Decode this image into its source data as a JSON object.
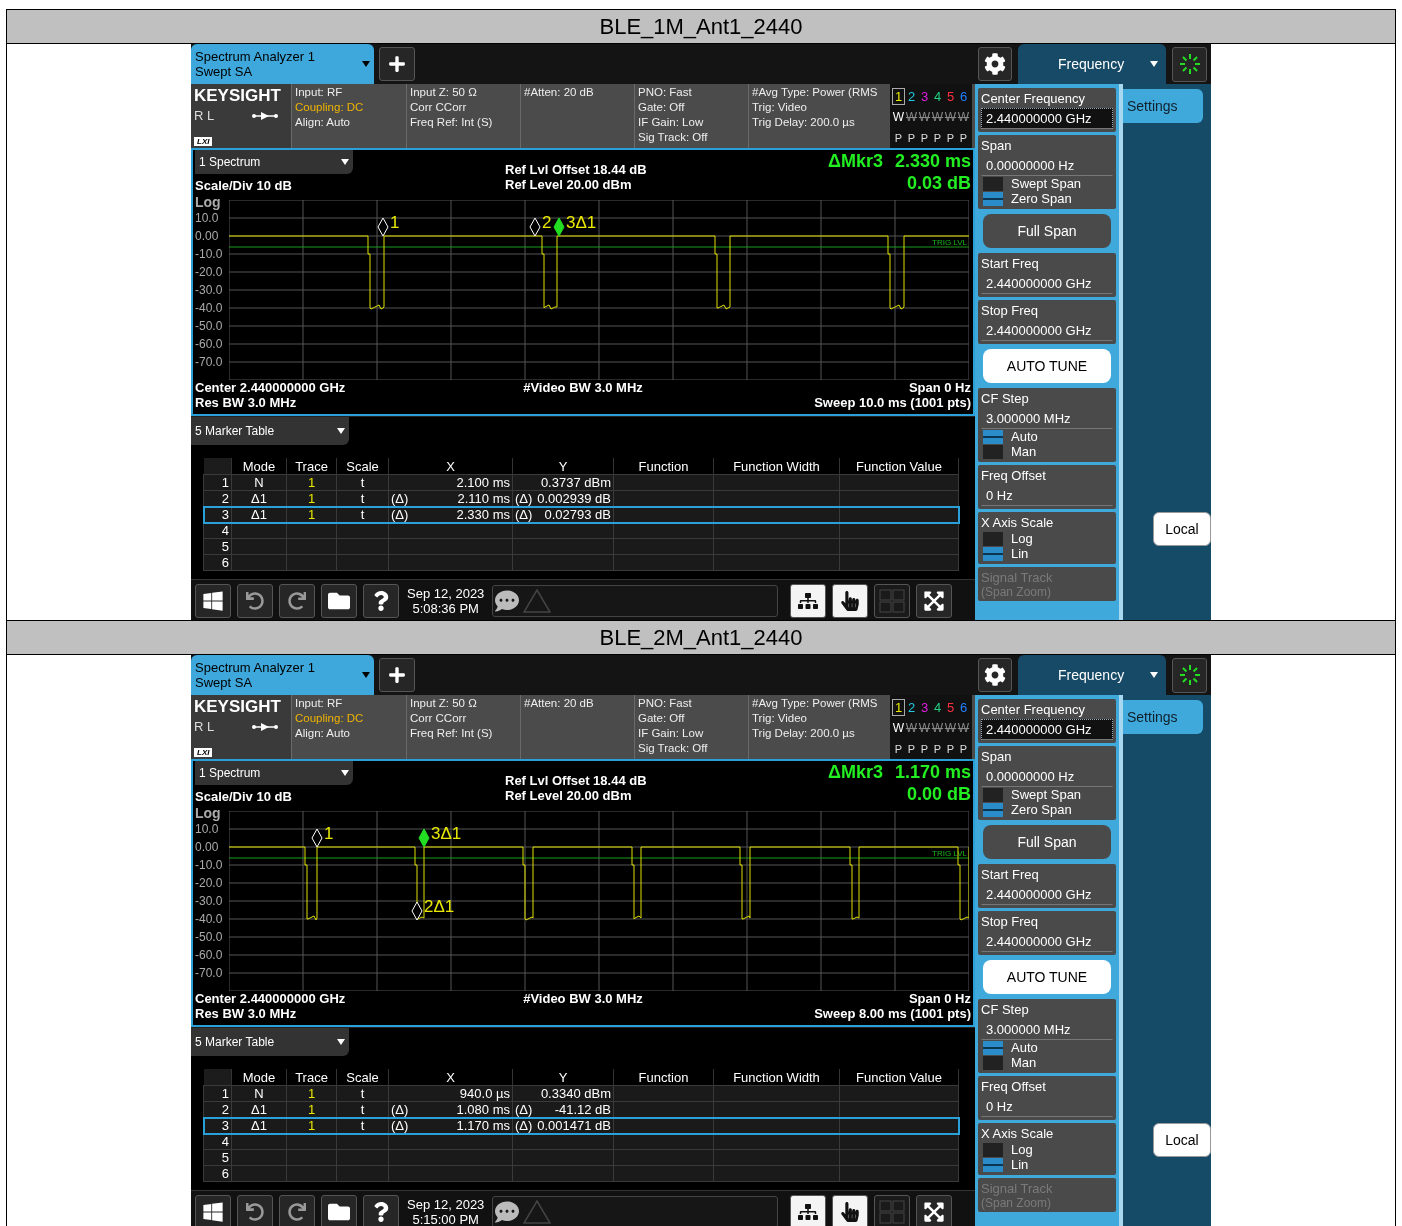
{
  "sections": [
    {
      "title": "BLE_1M_Ant1_2440",
      "instrument_tab": {
        "line_1": "Spectrum Analyzer 1",
        "line_2": "Swept SA"
      },
      "brand": {
        "logo": "KEYSIGHT",
        "status": "R L",
        "lxi": "LXI"
      },
      "settings": [
        [
          {
            "text": "Input: RF",
            "warning": false
          },
          {
            "text": "Coupling: DC",
            "warning": true
          },
          {
            "text": "Align: Auto",
            "warning": false
          }
        ],
        [
          {
            "text": "Input Z: 50 Ω",
            "warning": false
          },
          {
            "text": "Corr CCorr",
            "warning": false
          },
          {
            "text": "Freq Ref: Int (S)",
            "warning": false
          }
        ],
        [
          {
            "text": "#Atten: 20 dB",
            "warning": false
          }
        ],
        [
          {
            "text": "PNO: Fast",
            "warning": false
          },
          {
            "text": "Gate: Off",
            "warning": false
          },
          {
            "text": "IF Gain: Low",
            "warning": false
          },
          {
            "text": "Sig Track: Off",
            "warning": false
          }
        ],
        [
          {
            "text": "#Avg Type: Power (RMS",
            "warning": false
          },
          {
            "text": "Trig: Video",
            "warning": false
          },
          {
            "text": "Trig Delay: 200.0 µs",
            "warning": false
          }
        ]
      ],
      "traces": [
        {
          "number": "1",
          "color": "#e8e800",
          "selected": true,
          "mode": "W",
          "active": true,
          "detector": "P"
        },
        {
          "number": "2",
          "color": "#22c8e0",
          "selected": false,
          "mode": "W",
          "active": false,
          "detector": "P"
        },
        {
          "number": "3",
          "color": "#e020e0",
          "selected": false,
          "mode": "W",
          "active": false,
          "detector": "P"
        },
        {
          "number": "4",
          "color": "#20d080",
          "selected": false,
          "mode": "W",
          "active": false,
          "detector": "P"
        },
        {
          "number": "5",
          "color": "#ff3040",
          "selected": false,
          "mode": "W",
          "active": false,
          "detector": "P"
        },
        {
          "number": "6",
          "color": "#2080ff",
          "selected": false,
          "mode": "W",
          "active": false,
          "detector": "P"
        }
      ],
      "menu": {
        "label": "Frequency"
      },
      "panel_tab": {
        "label": "Settings",
        "selected": true
      },
      "softkeys": [
        {
          "kind": "field",
          "label": "Center Frequency",
          "value": "2.440000000 GHz",
          "focused": true
        },
        {
          "kind": "field",
          "label": "Span",
          "value": "0.00000000 Hz",
          "focused": false,
          "options": [
            {
              "label": "Swept Span",
              "selected": false
            },
            {
              "label": "Zero Span",
              "selected": true
            }
          ]
        },
        {
          "kind": "button",
          "label": "Full Span"
        },
        {
          "kind": "field",
          "label": "Start Freq",
          "value": "2.440000000 GHz",
          "focused": false
        },
        {
          "kind": "field",
          "label": "Stop Freq",
          "value": "2.440000000 GHz",
          "focused": false
        },
        {
          "kind": "action",
          "label": "AUTO TUNE"
        },
        {
          "kind": "field",
          "label": "CF Step",
          "value": "3.000000 MHz",
          "focused": false,
          "options": [
            {
              "label": "Auto",
              "selected": true
            },
            {
              "label": "Man",
              "selected": false
            }
          ]
        },
        {
          "kind": "field",
          "label": "Freq Offset",
          "value": "0 Hz",
          "focused": false
        },
        {
          "kind": "toggle",
          "label": "X Axis Scale",
          "options": [
            {
              "label": "Log",
              "selected": false
            },
            {
              "label": "Lin",
              "selected": true
            }
          ]
        },
        {
          "kind": "label",
          "label": "Signal Track",
          "sub": "(Span Zoom)",
          "disabled": true
        }
      ],
      "local_button": "Local",
      "spectrum": {
        "view": "1 Spectrum",
        "ref_offset": "Ref Lvl Offset 18.44 dB",
        "ref_level": "Ref Level 20.00 dBm",
        "scale": "Scale/Div 10 dB",
        "scale_type": "Log",
        "marker_readout": {
          "label": "ΔMkr3",
          "x": "2.330 ms",
          "y": "0.03 dB"
        },
        "y_labels": [
          "10.0",
          "0.00",
          "-10.0",
          "-20.0",
          "-30.0",
          "-40.0",
          "-50.0",
          "-60.0",
          "-70.0"
        ],
        "trigger_label": "TRIG LVL",
        "markers": [
          {
            "label": "1",
            "active": false
          },
          {
            "label": "2",
            "active": false
          },
          {
            "label": "3Δ1",
            "active": true
          }
        ],
        "footer": {
          "center": "Center 2.440000000 GHz",
          "video_bw": "#Video BW 3.0 MHz",
          "span": "Span 0 Hz",
          "res_bw": "Res BW 3.0 MHz",
          "sweep": "Sweep 10.0 ms (1001 pts)"
        }
      },
      "marker_table": {
        "view": "5 Marker Table",
        "columns": [
          "Mode",
          "Trace",
          "Scale",
          "X",
          "Y",
          "Function",
          "Function Width",
          "Function Value"
        ],
        "rows": [
          {
            "index": "1",
            "mode": "N",
            "trace": "1",
            "scale": "t",
            "x": "2.100 ms",
            "y": "0.3737 dBm",
            "selected": false
          },
          {
            "index": "2",
            "mode": "Δ1",
            "trace": "1",
            "scale": "t",
            "x_ref": "(Δ)",
            "x": "2.110 ms",
            "y_ref": "(Δ)",
            "y": "0.002939 dB",
            "selected": false
          },
          {
            "index": "3",
            "mode": "Δ1",
            "trace": "1",
            "scale": "t",
            "x_ref": "(Δ)",
            "x": "2.330 ms",
            "y_ref": "(Δ)",
            "y": "0.02793 dB",
            "selected": true
          },
          {
            "index": "4",
            "selected": false
          },
          {
            "index": "5",
            "selected": false
          },
          {
            "index": "6",
            "selected": false
          }
        ]
      },
      "taskbar": {
        "date": "Sep 12, 2023",
        "time": "5:08:36 PM"
      }
    },
    {
      "title": "BLE_2M_Ant1_2440",
      "instrument_tab": {
        "line_1": "Spectrum Analyzer 1",
        "line_2": "Swept SA"
      },
      "brand": {
        "logo": "KEYSIGHT",
        "status": "R L",
        "lxi": "LXI"
      },
      "settings": [
        [
          {
            "text": "Input: RF",
            "warning": false
          },
          {
            "text": "Coupling: DC",
            "warning": true
          },
          {
            "text": "Align: Auto",
            "warning": false
          }
        ],
        [
          {
            "text": "Input Z: 50 Ω",
            "warning": false
          },
          {
            "text": "Corr CCorr",
            "warning": false
          },
          {
            "text": "Freq Ref: Int (S)",
            "warning": false
          }
        ],
        [
          {
            "text": "#Atten: 20 dB",
            "warning": false
          }
        ],
        [
          {
            "text": "PNO: Fast",
            "warning": false
          },
          {
            "text": "Gate: Off",
            "warning": false
          },
          {
            "text": "IF Gain: Low",
            "warning": false
          },
          {
            "text": "Sig Track: Off",
            "warning": false
          }
        ],
        [
          {
            "text": "#Avg Type: Power (RMS",
            "warning": false
          },
          {
            "text": "Trig: Video",
            "warning": false
          },
          {
            "text": "Trig Delay: 200.0 µs",
            "warning": false
          }
        ]
      ],
      "traces": [
        {
          "number": "1",
          "color": "#e8e800",
          "selected": true,
          "mode": "W",
          "active": true,
          "detector": "P"
        },
        {
          "number": "2",
          "color": "#22c8e0",
          "selected": false,
          "mode": "W",
          "active": false,
          "detector": "P"
        },
        {
          "number": "3",
          "color": "#e020e0",
          "selected": false,
          "mode": "W",
          "active": false,
          "detector": "P"
        },
        {
          "number": "4",
          "color": "#20d080",
          "selected": false,
          "mode": "W",
          "active": false,
          "detector": "P"
        },
        {
          "number": "5",
          "color": "#ff3040",
          "selected": false,
          "mode": "W",
          "active": false,
          "detector": "P"
        },
        {
          "number": "6",
          "color": "#2080ff",
          "selected": false,
          "mode": "W",
          "active": false,
          "detector": "P"
        }
      ],
      "menu": {
        "label": "Frequency"
      },
      "panel_tab": {
        "label": "Settings",
        "selected": true
      },
      "softkeys": [
        {
          "kind": "field",
          "label": "Center Frequency",
          "value": "2.440000000 GHz",
          "focused": true
        },
        {
          "kind": "field",
          "label": "Span",
          "value": "0.00000000 Hz",
          "focused": false,
          "options": [
            {
              "label": "Swept Span",
              "selected": false
            },
            {
              "label": "Zero Span",
              "selected": true
            }
          ]
        },
        {
          "kind": "button",
          "label": "Full Span"
        },
        {
          "kind": "field",
          "label": "Start Freq",
          "value": "2.440000000 GHz",
          "focused": false
        },
        {
          "kind": "field",
          "label": "Stop Freq",
          "value": "2.440000000 GHz",
          "focused": false
        },
        {
          "kind": "action",
          "label": "AUTO TUNE"
        },
        {
          "kind": "field",
          "label": "CF Step",
          "value": "3.000000 MHz",
          "focused": false,
          "options": [
            {
              "label": "Auto",
              "selected": true
            },
            {
              "label": "Man",
              "selected": false
            }
          ]
        },
        {
          "kind": "field",
          "label": "Freq Offset",
          "value": "0 Hz",
          "focused": false
        },
        {
          "kind": "toggle",
          "label": "X Axis Scale",
          "options": [
            {
              "label": "Log",
              "selected": false
            },
            {
              "label": "Lin",
              "selected": true
            }
          ]
        },
        {
          "kind": "label",
          "label": "Signal Track",
          "sub": "(Span Zoom)",
          "disabled": true
        }
      ],
      "local_button": "Local",
      "spectrum": {
        "view": "1 Spectrum",
        "ref_offset": "Ref Lvl Offset 18.44 dB",
        "ref_level": "Ref Level 20.00 dBm",
        "scale": "Scale/Div 10 dB",
        "scale_type": "Log",
        "marker_readout": {
          "label": "ΔMkr3",
          "x": "1.170 ms",
          "y": "0.00 dB"
        },
        "y_labels": [
          "10.0",
          "0.00",
          "-10.0",
          "-20.0",
          "-30.0",
          "-40.0",
          "-50.0",
          "-60.0",
          "-70.0"
        ],
        "trigger_label": "TRIG LVL",
        "markers": [
          {
            "label": "1",
            "active": false
          },
          {
            "label": "2Δ1",
            "active": false
          },
          {
            "label": "3Δ1",
            "active": true
          }
        ],
        "footer": {
          "center": "Center 2.440000000 GHz",
          "video_bw": "#Video BW 3.0 MHz",
          "span": "Span 0 Hz",
          "res_bw": "Res BW 3.0 MHz",
          "sweep": "Sweep 8.00 ms (1001 pts)"
        }
      },
      "marker_table": {
        "view": "5 Marker Table",
        "columns": [
          "Mode",
          "Trace",
          "Scale",
          "X",
          "Y",
          "Function",
          "Function Width",
          "Function Value"
        ],
        "rows": [
          {
            "index": "1",
            "mode": "N",
            "trace": "1",
            "scale": "t",
            "x": "940.0 µs",
            "y": "0.3340 dBm",
            "selected": false
          },
          {
            "index": "2",
            "mode": "Δ1",
            "trace": "1",
            "scale": "t",
            "x_ref": "(Δ)",
            "x": "1.080 ms",
            "y_ref": "(Δ)",
            "y": "-41.12 dB",
            "selected": false
          },
          {
            "index": "3",
            "mode": "Δ1",
            "trace": "1",
            "scale": "t",
            "x_ref": "(Δ)",
            "x": "1.170 ms",
            "y_ref": "(Δ)",
            "y": "0.001471 dB",
            "selected": true
          },
          {
            "index": "4",
            "selected": false
          },
          {
            "index": "5",
            "selected": false
          },
          {
            "index": "6",
            "selected": false
          }
        ]
      },
      "taskbar": {
        "date": "Sep 12, 2023",
        "time": "5:15:00 PM"
      }
    }
  ]
}
